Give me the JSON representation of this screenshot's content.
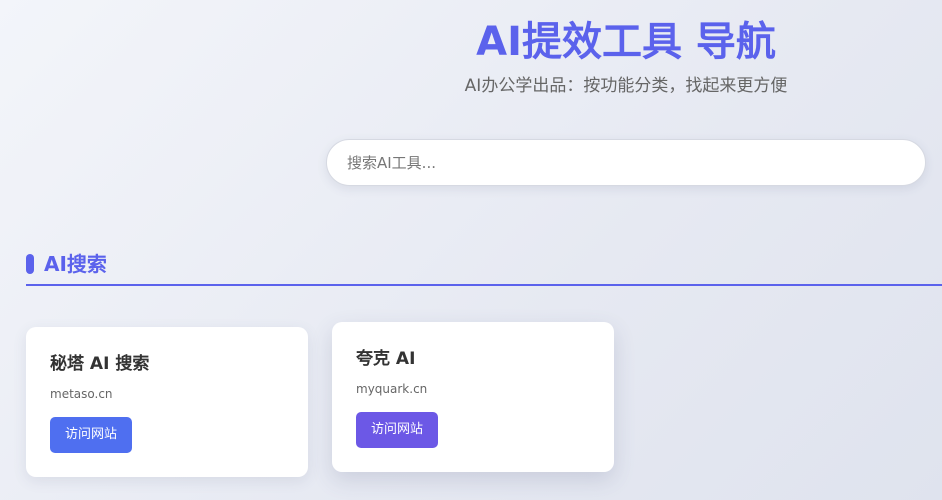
{
  "header": {
    "title": "AI提效工具 导航",
    "subtitle": "AI办公学出品：按功能分类，找起来更方便"
  },
  "search": {
    "placeholder": "搜索AI工具...",
    "value": ""
  },
  "section": {
    "title": "AI搜索"
  },
  "cards": [
    {
      "title": "秘塔 AI 搜索",
      "url": "metaso.cn",
      "button_label": "访问网站",
      "button_color": "#4f6ff0"
    },
    {
      "title": "夸克 AI",
      "url": "myquark.cn",
      "button_label": "访问网站",
      "button_color": "#6c58e6"
    }
  ],
  "colors": {
    "accent": "#5b62ec"
  }
}
